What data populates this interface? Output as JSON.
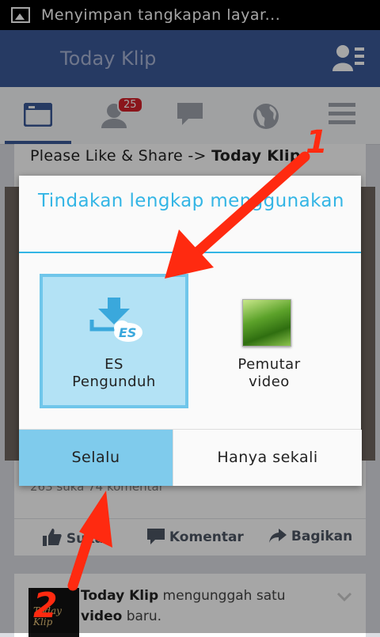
{
  "status_bar": {
    "notification_text": "Menyimpan tangkapan layar..."
  },
  "action_bar": {
    "title": "Today Klip"
  },
  "tabs": {
    "notifications_badge": "25"
  },
  "post": {
    "text_prefix": "Please Like & Share -> ",
    "text_link": "Today Klip",
    "stats": "263 suka   74 komentar",
    "actions": {
      "like": "Suka",
      "comment": "Komentar",
      "share": "Bagikan"
    }
  },
  "post2": {
    "avatar_text": "Today Klip",
    "author": "Today Klip",
    "action": " mengunggah satu",
    "object": "video",
    "suffix": " baru."
  },
  "dialog": {
    "title": "Tindakan lengkap menggunakan",
    "options": [
      {
        "line1": "ES",
        "line2": "Pengunduh"
      },
      {
        "line1": "Pemutar",
        "line2": "video"
      }
    ],
    "always_button": "Selalu",
    "once_button": "Hanya sekali"
  },
  "annotations": {
    "arrow1_number": "1",
    "arrow2_number": "2"
  },
  "colors": {
    "facebook_blue": "#3b5998",
    "holo_blue": "#33b5e5",
    "annotation_red": "#ff2a10"
  }
}
